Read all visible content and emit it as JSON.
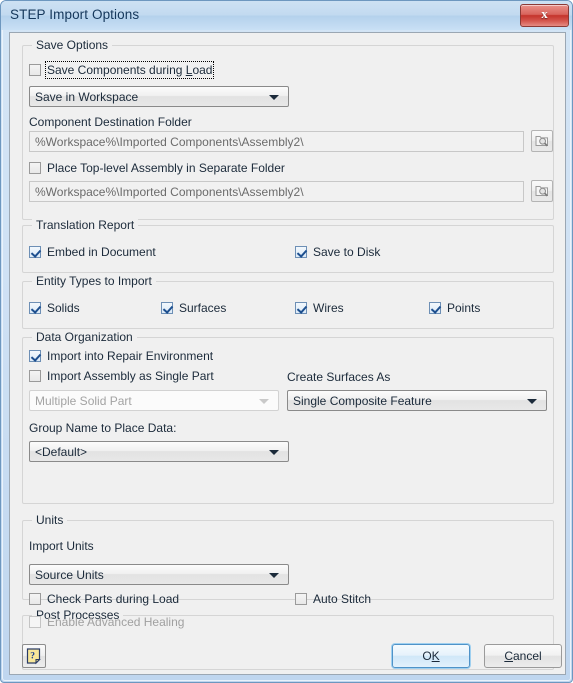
{
  "window": {
    "title": "STEP Import Options",
    "close_glyph": "x",
    "accent_blue": "#4f93c8",
    "title_color": "#14375b",
    "client_bg": "#f0f0f0",
    "close_red": "#c4342c"
  },
  "save_options": {
    "group_title": "Save Options",
    "save_components_checkbox": {
      "label_pre": "Save Components during ",
      "label_accel": "L",
      "label_post": "oad",
      "checked": false,
      "focused": true
    },
    "save_location_combo": {
      "value": "Save in Workspace"
    },
    "destination_label": "Component Destination Folder",
    "destination_path": "%Workspace%\\Imported Components\\Assembly2\\",
    "place_top_level_checkbox": {
      "label": "Place Top-level Assembly in Separate Folder",
      "checked": false
    },
    "separate_folder_path": "%Workspace%\\Imported Components\\Assembly2\\",
    "browse_icon": "folder-search-icon"
  },
  "translation_report": {
    "group_title": "Translation Report",
    "items": [
      {
        "label": "Embed in Document",
        "checked": true
      },
      {
        "label": "Save to Disk",
        "checked": true
      }
    ]
  },
  "entity_types": {
    "group_title": "Entity Types to Import",
    "items": [
      {
        "label": "Solids",
        "checked": true
      },
      {
        "label": "Surfaces",
        "checked": true
      },
      {
        "label": "Wires",
        "checked": true
      },
      {
        "label": "Points",
        "checked": true
      }
    ]
  },
  "data_organization": {
    "group_title": "Data Organization",
    "import_repair_checkbox": {
      "label": "Import into Repair Environment",
      "checked": true
    },
    "import_single_part_checkbox": {
      "label": "Import Assembly as Single Part",
      "checked": false
    },
    "single_part_combo": {
      "value": "Multiple Solid Part",
      "disabled": true
    },
    "create_surfaces_label": "Create Surfaces As",
    "create_surfaces_combo": {
      "value": "Single Composite Feature"
    },
    "group_name_label": "Group Name to Place Data:",
    "group_name_combo": {
      "value": "<Default>"
    }
  },
  "units": {
    "group_title": "Units",
    "import_units_label": "Import Units",
    "import_units_combo": {
      "value": "Source Units"
    }
  },
  "post_processes": {
    "group_title": "Post Processes",
    "check_parts_checkbox": {
      "label": "Check Parts during Load",
      "checked": false
    },
    "auto_stitch_checkbox": {
      "label": "Auto Stitch",
      "checked": false
    },
    "advanced_healing_checkbox": {
      "label": "Enable Advanced Healing",
      "checked": false,
      "disabled": true
    }
  },
  "footer": {
    "help_icon": "help-note-icon",
    "ok": {
      "label_pre": "O",
      "label_accel": "K",
      "label_post": ""
    },
    "cancel": {
      "label_pre": "",
      "label_accel": "C",
      "label_post": "ancel"
    }
  }
}
